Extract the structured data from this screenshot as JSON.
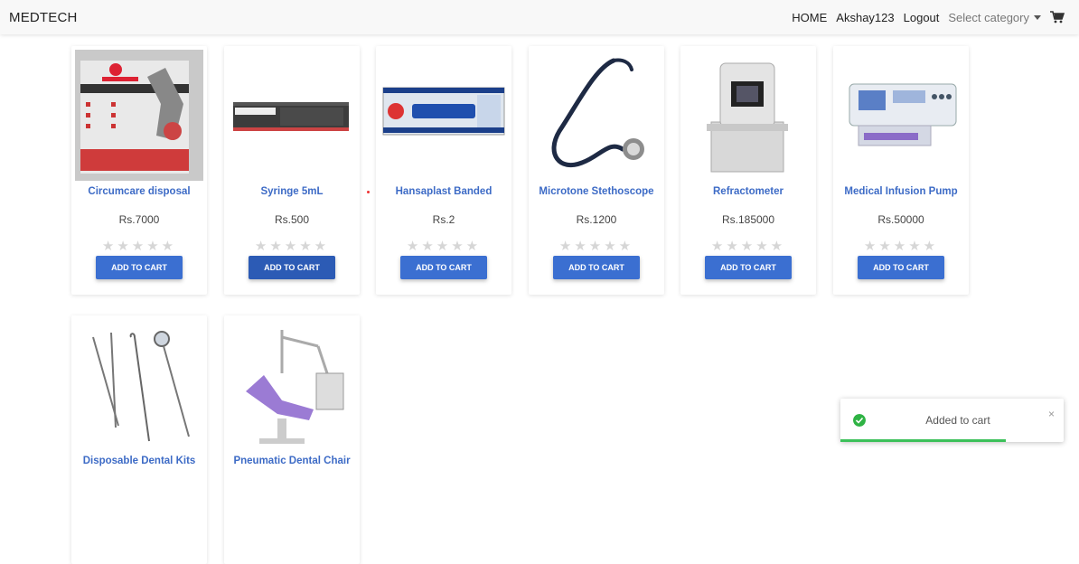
{
  "navbar": {
    "brand": "MEDTECH",
    "home": "HOME",
    "user": "Akshay123",
    "logout": "Logout",
    "category_placeholder": "Select category",
    "cart_icon": "cart-icon"
  },
  "products": [
    {
      "name": "Circumcare disposal",
      "price": "Rs.7000",
      "button": "ADD TO CART",
      "rating": 0,
      "image": "circumcare-box"
    },
    {
      "name": "Syringe 5mL",
      "price": "Rs.500",
      "button": "ADD TO CART",
      "rating": 0,
      "image": "syringe-box"
    },
    {
      "name": "Hansaplast Banded",
      "price": "Rs.2",
      "button": "ADD TO CART",
      "rating": 0,
      "image": "bandage"
    },
    {
      "name": "Microtone Stethoscope",
      "price": "Rs.1200",
      "button": "ADD TO CART",
      "rating": 0,
      "image": "stethoscope"
    },
    {
      "name": "Refractometer",
      "price": "Rs.185000",
      "button": "ADD TO CART",
      "rating": 0,
      "image": "refractometer"
    },
    {
      "name": "Medical Infusion Pump",
      "price": "Rs.50000",
      "button": "ADD TO CART",
      "rating": 0,
      "image": "infusion-pump"
    },
    {
      "name": "Disposable Dental Kits",
      "price": "",
      "button": "",
      "rating": 0,
      "image": "dental-tools"
    },
    {
      "name": "Pneumatic Dental Chair",
      "price": "",
      "button": "",
      "rating": 0,
      "image": "dental-chair"
    }
  ],
  "toast": {
    "message": "Added to cart",
    "close": "×",
    "progress": 0.74
  },
  "colors": {
    "accent": "#3b6fd1",
    "title": "#3d6bc6",
    "success": "#2fb344"
  }
}
